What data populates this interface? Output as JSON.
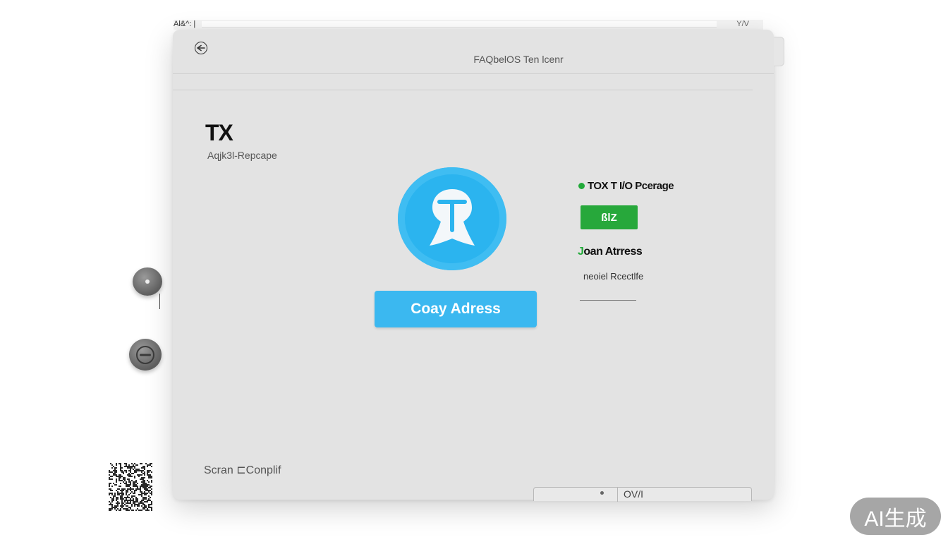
{
  "top_strip": {
    "left_text": "Al&^: |",
    "right_text": "Y/V"
  },
  "window": {
    "title": "FAQbelOS Ten lcenr",
    "heading": "TX",
    "subheading": "Aqjk3l-Repcape"
  },
  "main": {
    "copy_button_label": "Coay Adress"
  },
  "info_panel": {
    "title": "TOX T I/O Pcerage",
    "amount": "ßlZ",
    "scan_title_accent": "J",
    "scan_title_rest": "oan Atrress",
    "scan_subtitle": "neoiel Rcectlfe"
  },
  "footer": {
    "label": "Scran ⊏Conplif",
    "field_button": "OV/I"
  },
  "watermark": "AI生成",
  "colors": {
    "accent_blue": "#2bb4ef",
    "accent_green": "#27a83b",
    "window_bg": "#e3e3e3"
  },
  "icons": {
    "back": "back-arrow-icon",
    "logo": "tx-logo-icon",
    "side_top": "disc-icon",
    "side_bottom": "minus-icon",
    "qr": "qr-code-icon"
  }
}
